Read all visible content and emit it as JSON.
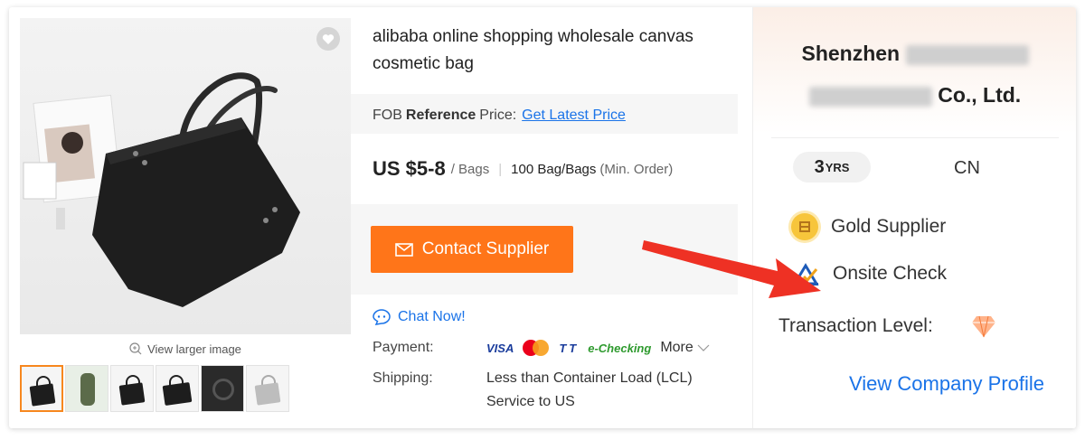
{
  "product": {
    "title": "alibaba online shopping wholesale canvas cosmetic bag",
    "view_larger": "View larger image",
    "thumbnail_count": 6
  },
  "pricing": {
    "fob_prefix": "FOB",
    "fob_bold": "Reference",
    "fob_suffix": "Price:",
    "latest_price_link": "Get Latest Price",
    "price": "US $5-8",
    "unit": "/ Bags",
    "moq": "100 Bag/Bags",
    "moq_note": "(Min. Order)"
  },
  "actions": {
    "contact_label": "Contact Supplier",
    "chat_label": "Chat Now!"
  },
  "details": {
    "payment_label": "Payment:",
    "payment_methods": [
      "VISA",
      "TT",
      "e-Checking"
    ],
    "more_label": "More",
    "shipping_label": "Shipping:",
    "shipping_line1": "Less than Container Load (LCL)",
    "shipping_line2": "Service to US"
  },
  "company": {
    "name_first": "Shenzhen",
    "name_last": "Co., Ltd.",
    "years_num": "3",
    "years_suffix": "YRS",
    "country": "CN",
    "gold_label": "Gold Supplier",
    "onsite_label": "Onsite Check",
    "transaction_label": "Transaction Level:",
    "profile_link": "View Company Profile"
  },
  "colors": {
    "accent_orange": "#ff7519",
    "link_blue": "#1a73e8",
    "arrow_red": "#ee3124",
    "gold": "#f7c53b"
  }
}
